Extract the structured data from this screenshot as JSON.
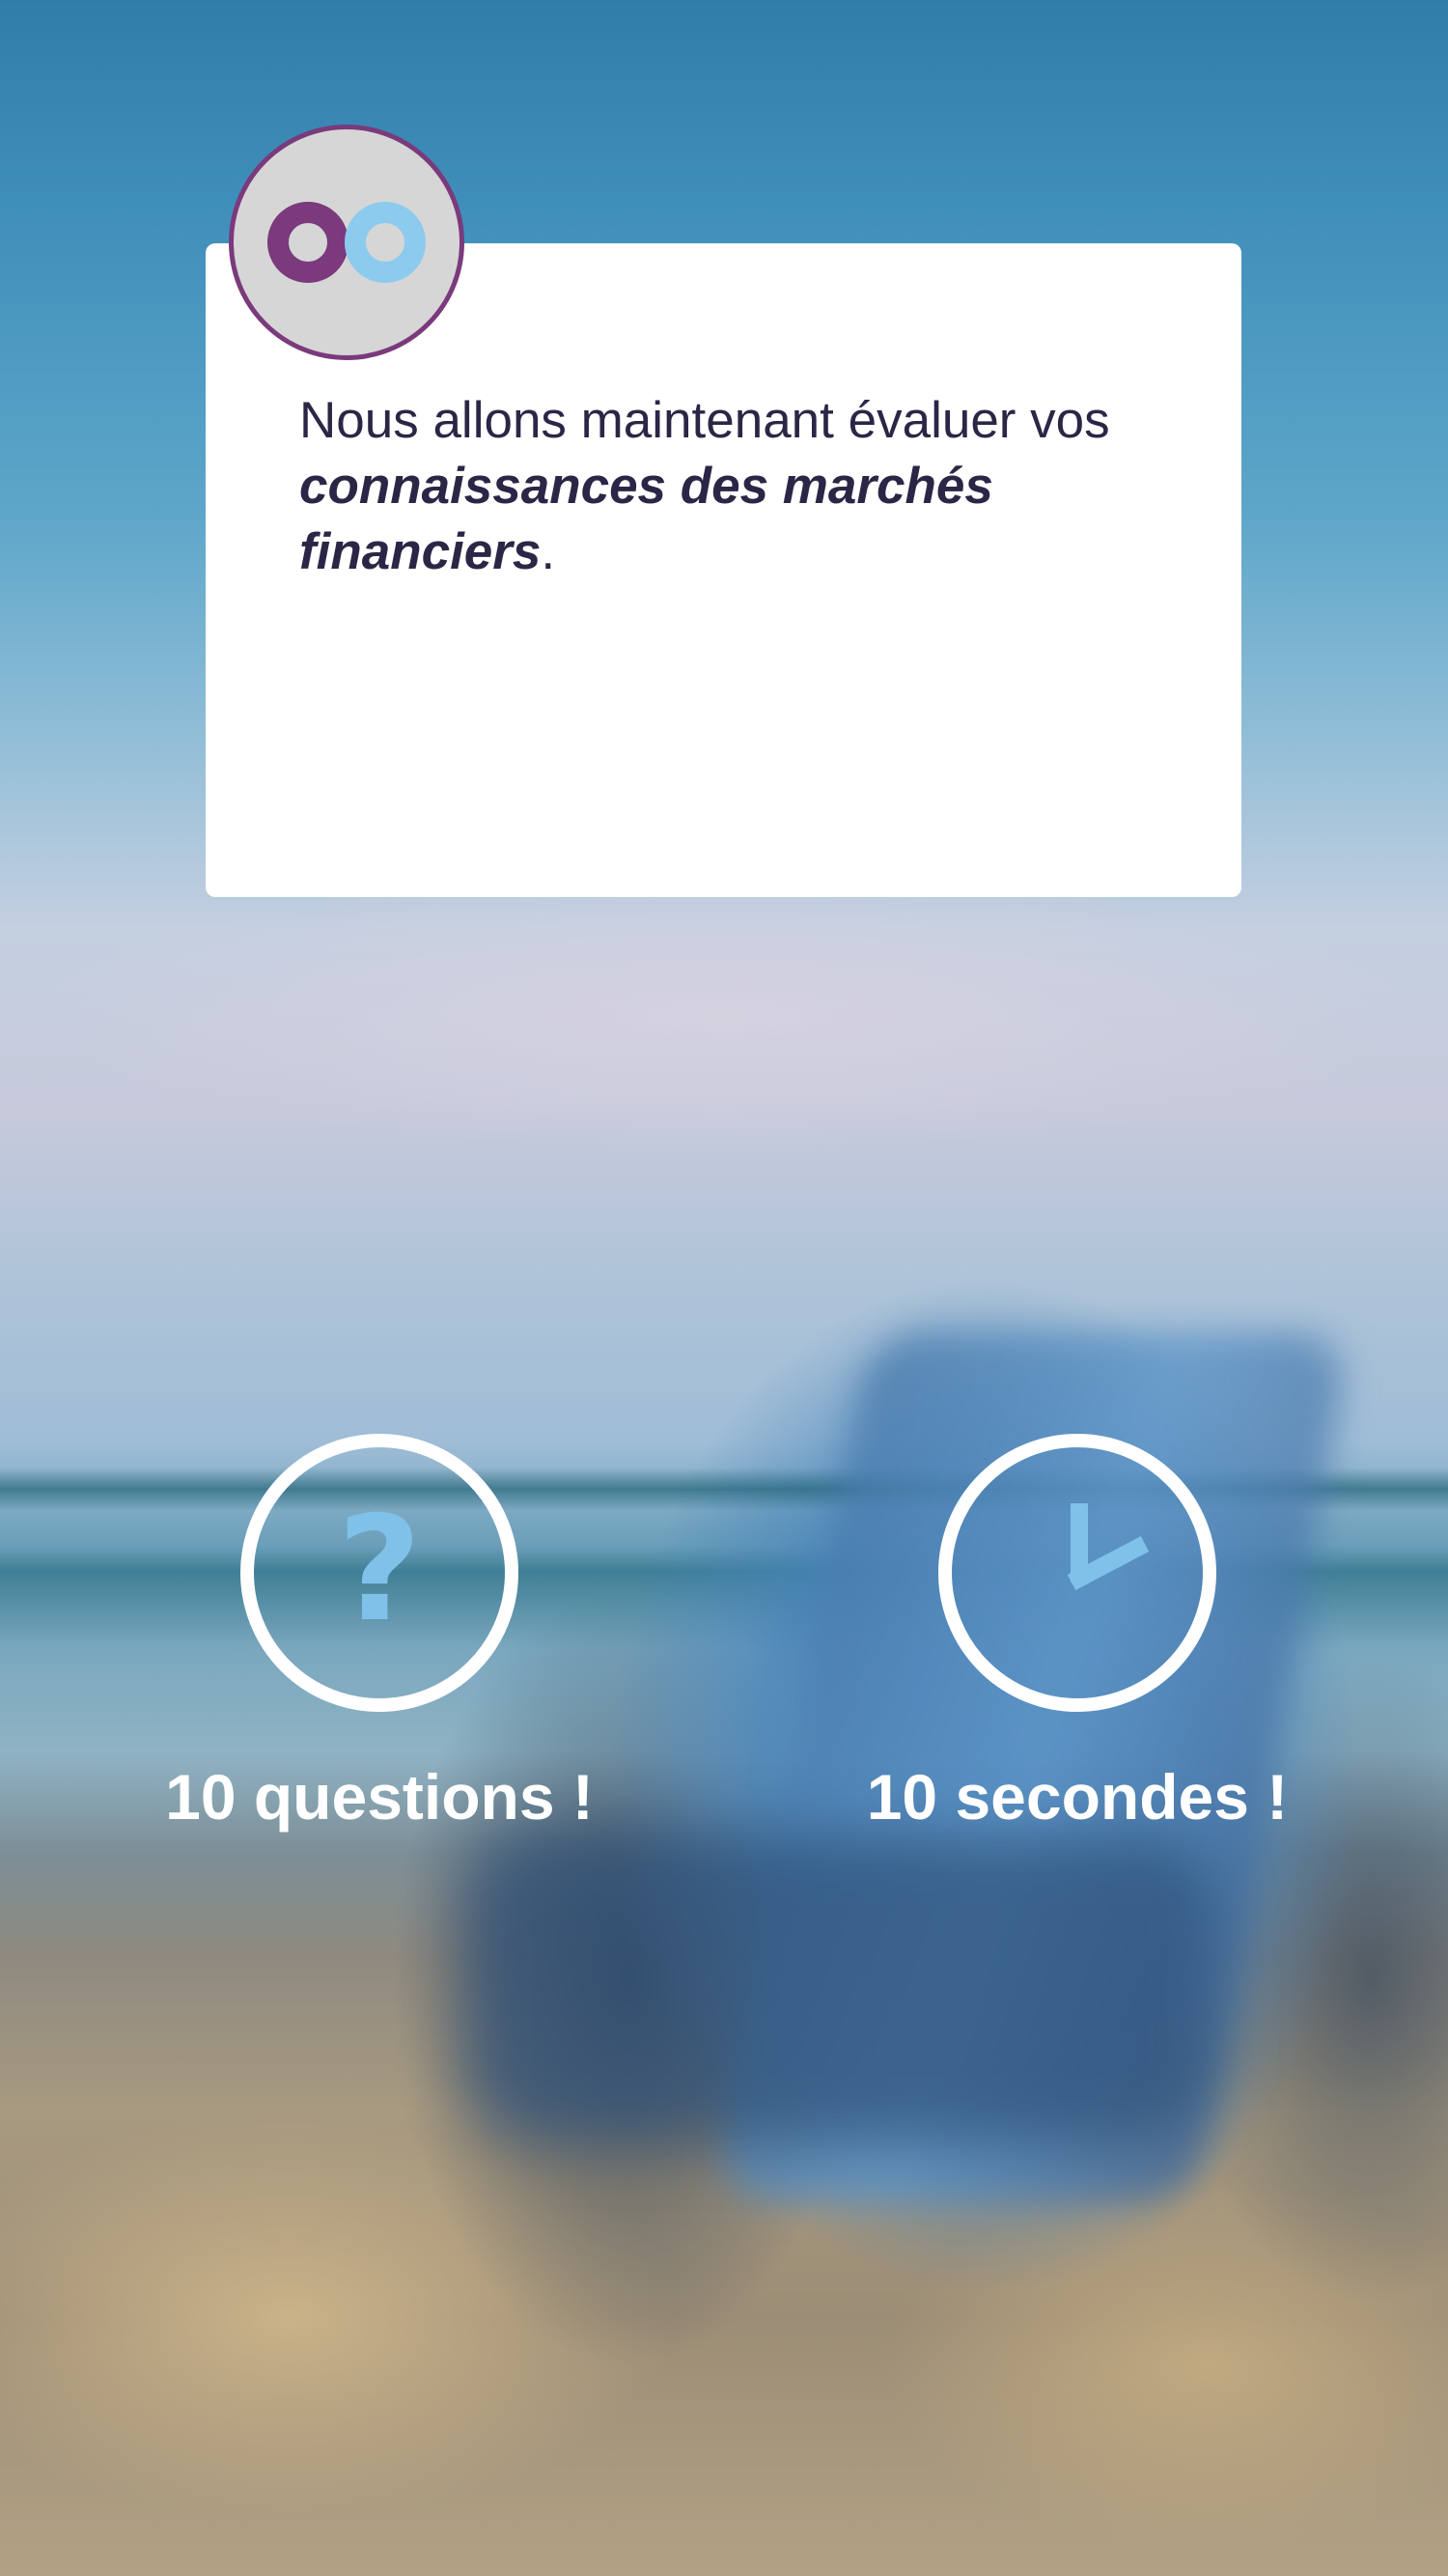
{
  "card": {
    "intro_text": "Nous allons maintenant évaluer vos ",
    "emphasis_text": "connaissances des marchés financiers",
    "end_punctuation": "."
  },
  "avatar": {
    "icon": "eyes-logo-icon",
    "colors": {
      "left_eye": "#7a3a7c",
      "right_eye": "#8ccbee",
      "background": "#d6d6d6"
    }
  },
  "features": [
    {
      "icon": "question-mark-icon",
      "symbol": "?",
      "label": "10 questions !"
    },
    {
      "icon": "clock-icon",
      "label": "10 secondes !"
    }
  ],
  "colors": {
    "accent": "#7fc1e9",
    "brand_purple": "#7a3a7c",
    "text_dark": "#2c2646"
  }
}
